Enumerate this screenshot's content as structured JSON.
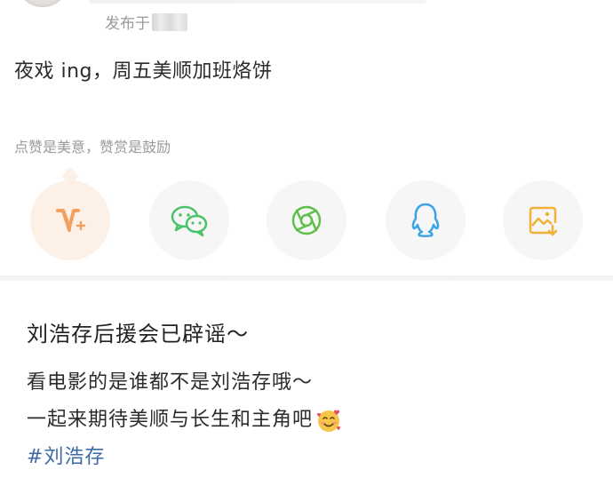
{
  "post": {
    "published_prefix": "发布于",
    "text": "夜戏 ing，周五美顺加班烙饼",
    "like_hint": "点赞是美意，赞赏是鼓励"
  },
  "share_buttons": [
    {
      "icon": "v-plus-icon",
      "color": "#f2a060"
    },
    {
      "icon": "wechat-icon",
      "color": "#4cc36b"
    },
    {
      "icon": "moments-icon",
      "color": "#5fbf4a"
    },
    {
      "icon": "qq-icon",
      "color": "#39a3e6"
    },
    {
      "icon": "save-image-icon",
      "color": "#f0b23a"
    }
  ],
  "card": {
    "title": "刘浩存后援会已辟谣～",
    "line1": "看电影的是谁都不是刘浩存哦～",
    "line2": "一起来期待美顺与长生和主角吧",
    "hashtag": "#刘浩存"
  },
  "colors": {
    "hashtag": "#3d6aa6",
    "muted_text": "#9b9b9b",
    "v_button_bg": "#fdf0e6"
  }
}
